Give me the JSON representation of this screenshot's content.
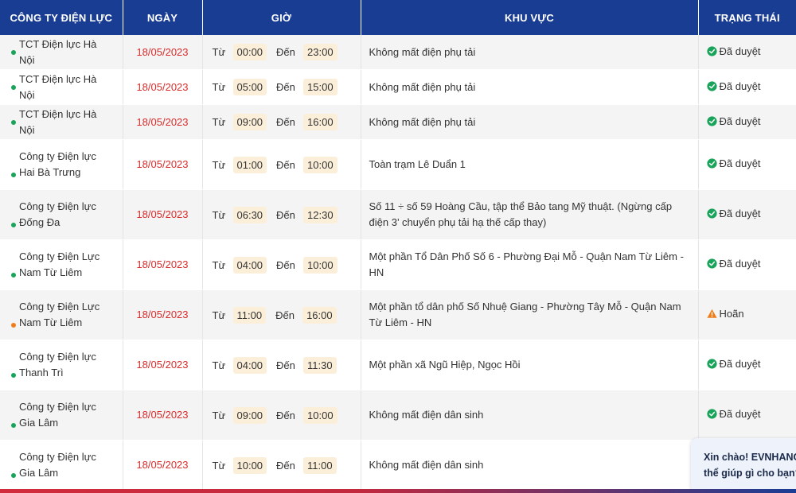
{
  "table": {
    "headers": [
      "CÔNG TY ĐIỆN LỰC",
      "NGÀY",
      "GIỜ",
      "KHU VỰC",
      "TRẠNG THÁI"
    ],
    "from_label": "Từ",
    "to_label": "Đến",
    "rows": [
      {
        "company": "TCT Điện lực Hà Nội",
        "date": "18/05/2023",
        "from": "00:00",
        "to": "23:00",
        "area": "Không mất điện phụ tải",
        "status": "Đã duyệt",
        "status_type": "approved"
      },
      {
        "company": "TCT Điện lực Hà Nội",
        "date": "18/05/2023",
        "from": "05:00",
        "to": "15:00",
        "area": "Không mất điện phụ tải",
        "status": "Đã duyệt",
        "status_type": "approved"
      },
      {
        "company": "TCT Điện lực Hà Nội",
        "date": "18/05/2023",
        "from": "09:00",
        "to": "16:00",
        "area": "Không mất điện phụ tải",
        "status": "Đã duyệt",
        "status_type": "approved"
      },
      {
        "company": "Công ty Điện lực Hai Bà Trưng",
        "date": "18/05/2023",
        "from": "01:00",
        "to": "10:00",
        "area": "Toàn trạm Lê Duẩn 1",
        "status": "Đã duyệt",
        "status_type": "approved"
      },
      {
        "company": "Công ty Điện lực Đống Đa",
        "date": "18/05/2023",
        "from": "06:30",
        "to": "12:30",
        "area": "Số 11 ÷ số 59 Hoàng Cầu, tập thể Bảo tang Mỹ thuật. (Ngừng cấp điện 3’ chuyển phụ tải hạ thế cấp thay)",
        "status": "Đã duyệt",
        "status_type": "approved"
      },
      {
        "company": "Công ty Điện Lực Nam Từ Liêm",
        "date": "18/05/2023",
        "from": "04:00",
        "to": "10:00",
        "area": "Một phần Tổ Dân Phố Số 6 - Phường Đại Mỗ - Quận Nam Từ Liêm - HN",
        "status": "Đã duyệt",
        "status_type": "approved"
      },
      {
        "company": "Công ty Điện Lực Nam Từ Liêm",
        "date": "18/05/2023",
        "from": "11:00",
        "to": "16:00",
        "area": "Một phần tổ dân phố Số Nhuệ Giang - Phường Tây Mỗ - Quận Nam Từ Liêm - HN",
        "status": "Hoãn",
        "status_type": "postponed"
      },
      {
        "company": "Công ty Điện lực Thanh Trì",
        "date": "18/05/2023",
        "from": "04:00",
        "to": "11:30",
        "area": "Một phần xã Ngũ Hiệp, Ngọc Hồi",
        "status": "Đã duyệt",
        "status_type": "approved"
      },
      {
        "company": "Công ty Điện lực Gia Lâm",
        "date": "18/05/2023",
        "from": "09:00",
        "to": "10:00",
        "area": "Không mất điện dân sinh",
        "status": "Đã duyệt",
        "status_type": "approved"
      },
      {
        "company": "Công ty Điện lực Gia Lâm",
        "date": "18/05/2023",
        "from": "10:00",
        "to": "11:00",
        "area": "Không mất điện dân sinh",
        "status": "",
        "status_type": "hidden"
      }
    ]
  },
  "chat": {
    "line1": "Xin chào! EVNHANOI có",
    "line2": "thể giúp gì cho bạn?"
  },
  "colors": {
    "header_bg": "#1a3d94",
    "date_red": "#d92c2c",
    "time_pill_bg": "#fcefd9",
    "approved_green": "#1aa35a",
    "postponed_orange": "#f07d1c"
  },
  "icons": {
    "approved": "check-circle-icon",
    "postponed": "warning-triangle-icon",
    "company_bullet": "dot-bullet-icon"
  }
}
